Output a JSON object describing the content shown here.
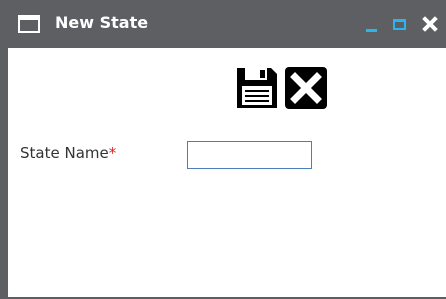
{
  "window": {
    "title": "New State",
    "icons": {
      "window": "window-icon",
      "minimize": "minimize-icon",
      "maximize": "maximize-icon",
      "close": "close-icon"
    }
  },
  "toolbar": {
    "save": "save-icon",
    "cancel": "close-box-icon"
  },
  "form": {
    "state_name": {
      "label": "State Name",
      "required_marker": "*",
      "value": "",
      "placeholder": ""
    }
  },
  "colors": {
    "titlebar": "#5d5f63",
    "window_controls": "#29b5f0",
    "required": "#e02020",
    "input_border": "#4a7fb8"
  }
}
